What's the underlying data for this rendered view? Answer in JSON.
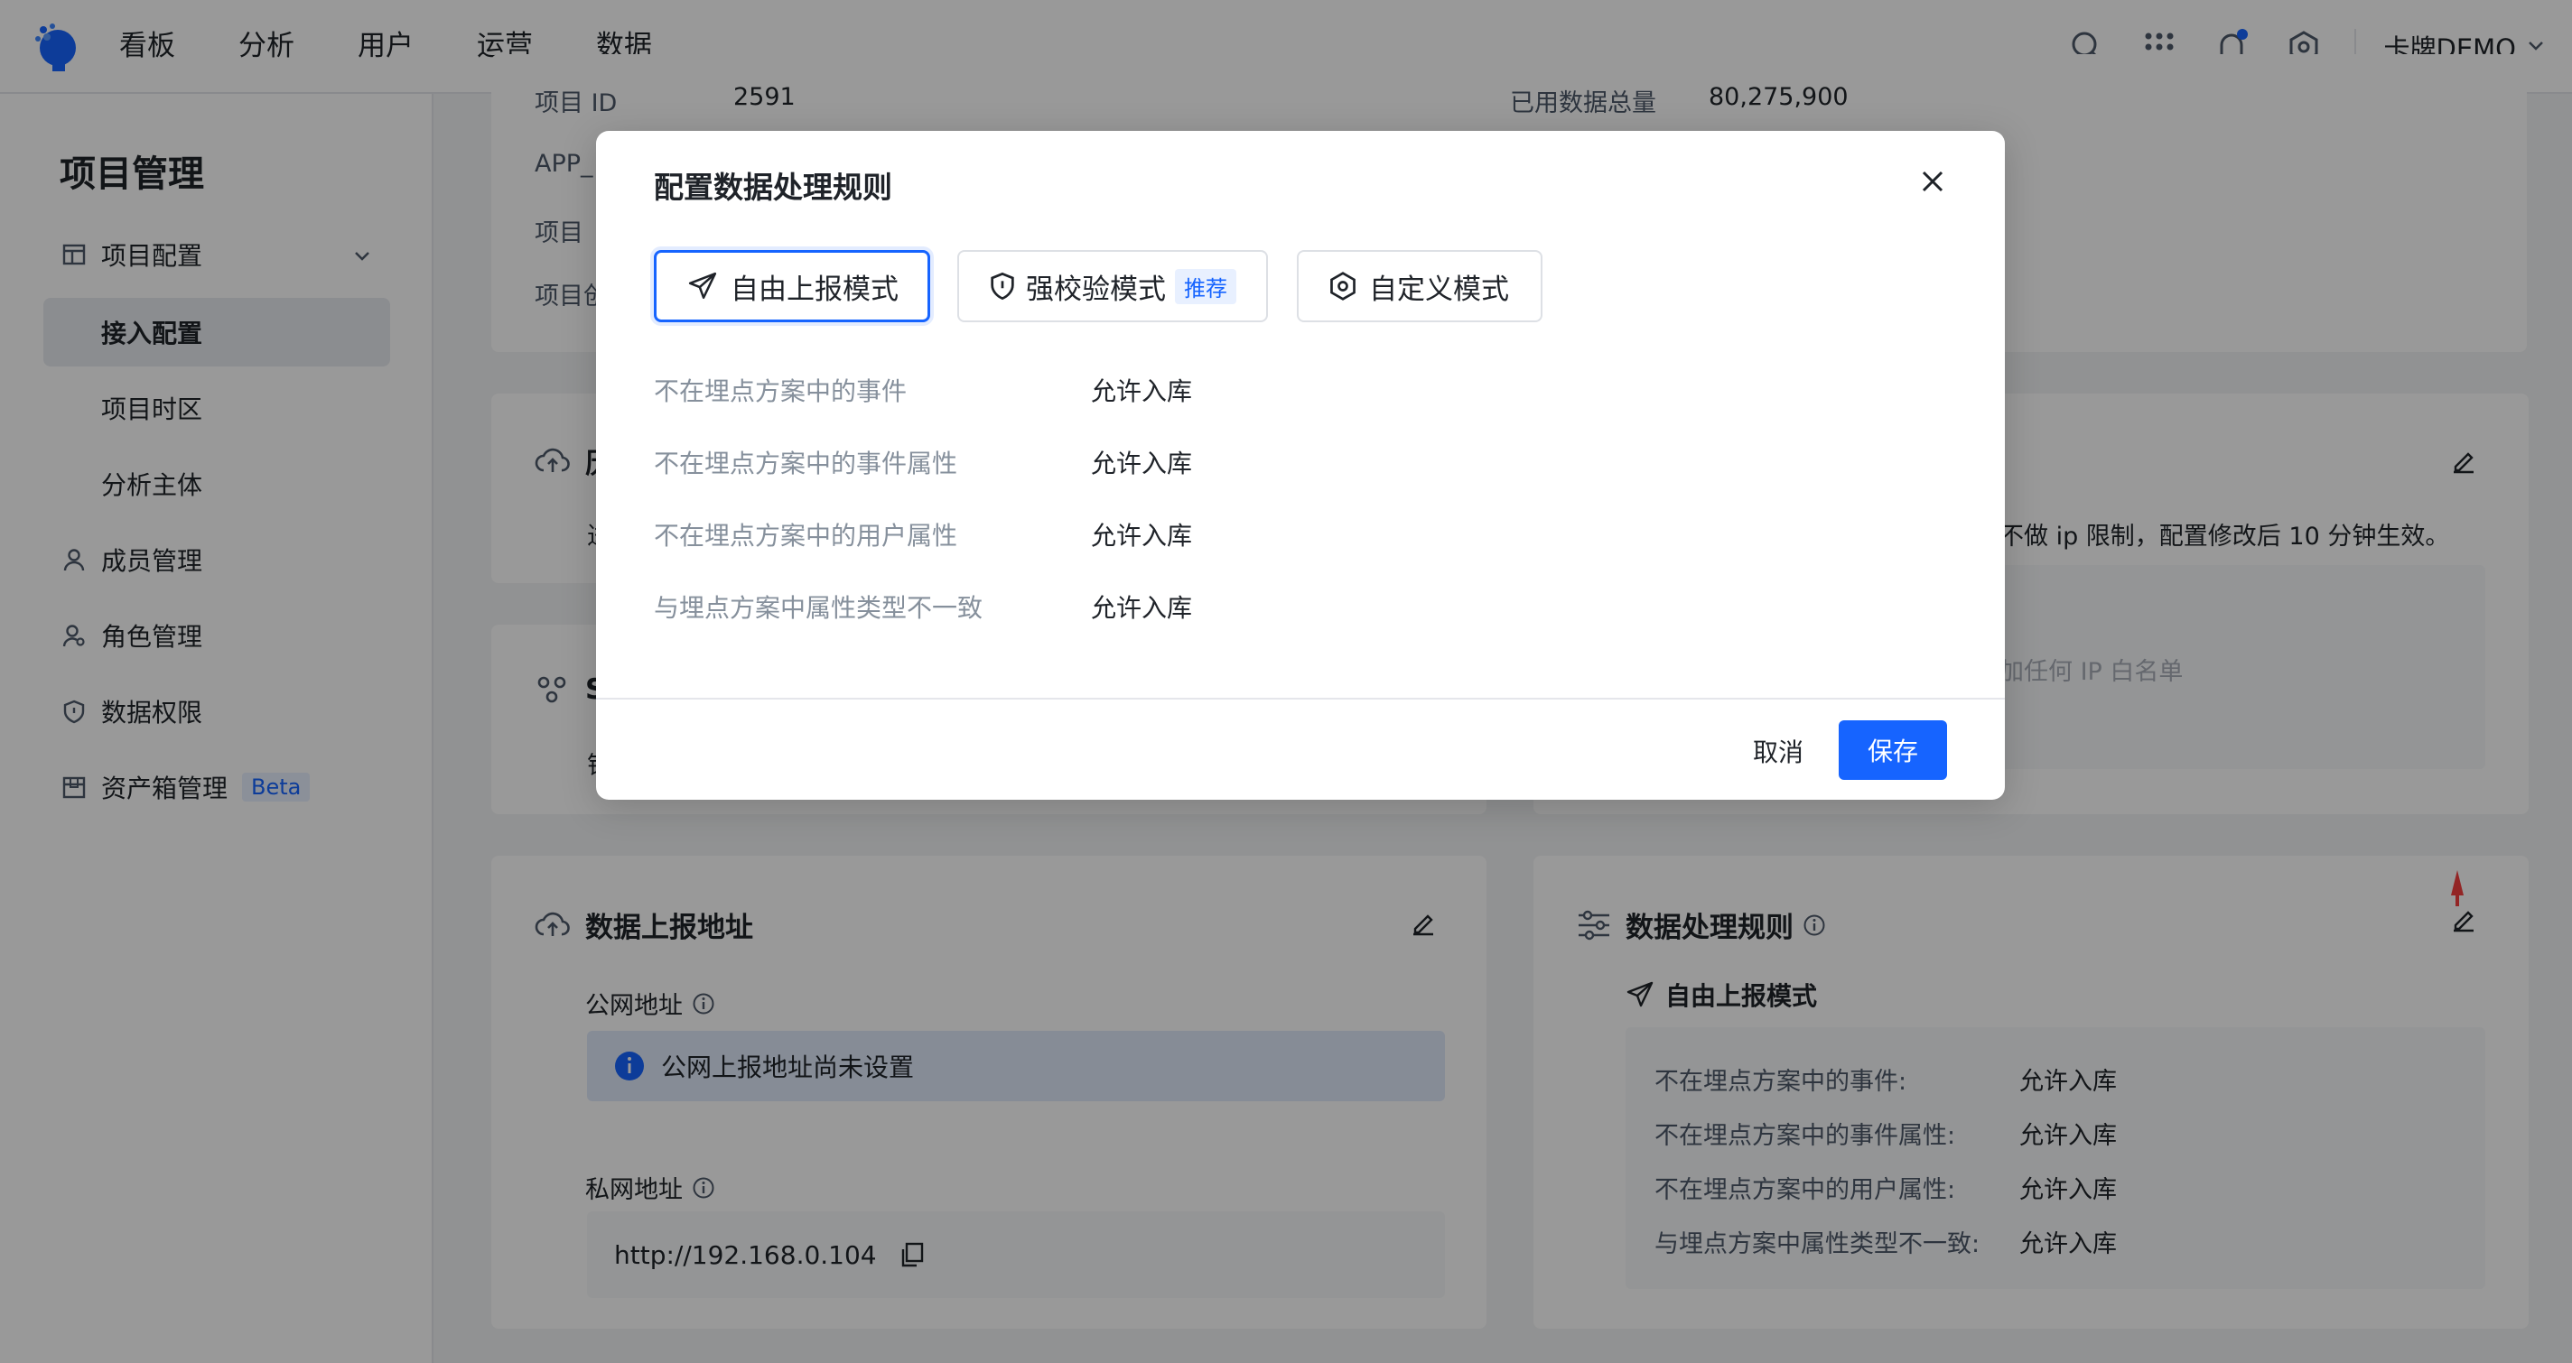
{
  "nav": {
    "items": [
      "看板",
      "分析",
      "用户",
      "运营",
      "数据"
    ],
    "user": "卡牌DEMO"
  },
  "sidebar": {
    "title": "项目管理",
    "items": [
      {
        "label": "项目配置",
        "icon": "project-config-icon"
      },
      {
        "label": "接入配置"
      },
      {
        "label": "项目时区"
      },
      {
        "label": "分析主体"
      },
      {
        "label": "成员管理",
        "icon": "user-icon"
      },
      {
        "label": "角色管理",
        "icon": "role-icon"
      },
      {
        "label": "数据权限",
        "icon": "shield-icon"
      },
      {
        "label": "资产箱管理",
        "icon": "box-icon",
        "badge": "Beta"
      }
    ]
  },
  "bg": {
    "project_id_label": "项目 ID",
    "project_id_value": "2591",
    "used_data_label": "已用数据总量",
    "used_data_value": "80,275,900",
    "app_label": "APP_",
    "project_row3": "项目",
    "project_row4": "项目创",
    "ip_text": "不做 ip 限制，配置修改后 10 分钟生效。",
    "ip_placeholder": "加任何 IP 白名单",
    "card2_title_partial": "历",
    "card2_sub": "进",
    "card3_title_partial": "S",
    "card3_sub": "钳"
  },
  "upload_card": {
    "title": "数据上报地址",
    "public_label": "公网地址",
    "public_alert": "公网上报地址尚未设置",
    "private_label": "私网地址",
    "private_url": "http://192.168.0.104"
  },
  "rules_card": {
    "title": "数据处理规则",
    "mode": "自由上报模式",
    "rules": [
      {
        "label": "不在埋点方案中的事件:",
        "value": "允许入库"
      },
      {
        "label": "不在埋点方案中的事件属性:",
        "value": "允许入库"
      },
      {
        "label": "不在埋点方案中的用户属性:",
        "value": "允许入库"
      },
      {
        "label": "与埋点方案中属性类型不一致:",
        "value": "允许入库"
      }
    ]
  },
  "modal": {
    "title": "配置数据处理规则",
    "modes": [
      {
        "label": "自由上报模式",
        "selected": true
      },
      {
        "label": "强校验模式",
        "tag": "推荐"
      },
      {
        "label": "自定义模式"
      }
    ],
    "rules": [
      {
        "label": "不在埋点方案中的事件",
        "value": "允许入库"
      },
      {
        "label": "不在埋点方案中的事件属性",
        "value": "允许入库"
      },
      {
        "label": "不在埋点方案中的用户属性",
        "value": "允许入库"
      },
      {
        "label": "与埋点方案中属性类型不一致",
        "value": "允许入库"
      }
    ],
    "cancel": "取消",
    "save": "保存"
  },
  "colors": {
    "primary": "#1664ff",
    "overlay": "rgba(0,0,0,0.40)",
    "alert_bg": "#dfe9fb"
  }
}
